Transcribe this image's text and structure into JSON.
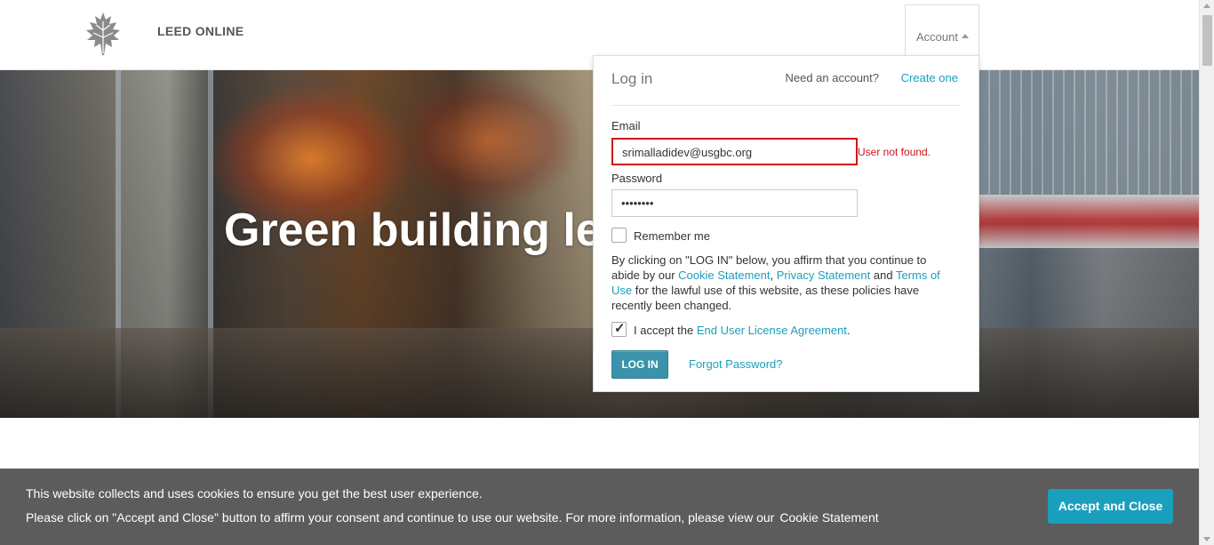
{
  "header": {
    "logo_icon": "usgbc-oak-leaf-logo",
    "brand": "LEED ONLINE",
    "account_label": "Account"
  },
  "hero": {
    "title": "Green building le"
  },
  "login": {
    "title": "Log in",
    "need_account": "Need an account?",
    "create_link": "Create one",
    "email_label": "Email",
    "email_value": "srimalladidev@usgbc.org",
    "email_error": "User not found.",
    "password_label": "Password",
    "password_value": "••••••••",
    "remember_label": "Remember me",
    "remember_checked": false,
    "terms_text_1": "By clicking on \"LOG IN\" below, you affirm that you continue to abide by our ",
    "cookie_link": "Cookie Statement",
    "comma": ", ",
    "privacy_link": "Privacy Statement",
    "and": " and ",
    "terms_link": "Terms of Use",
    "terms_text_2": " for the lawful use of this website, as these policies have recently been changed.",
    "accept_prefix": "I accept the ",
    "eula_link": "End User License Agreement",
    "accept_suffix": ".",
    "accept_checked": true,
    "login_button": "LOG IN",
    "forgot_link": "Forgot Password?"
  },
  "cookie_bar": {
    "line1": "This website collects and uses cookies to ensure you get the best user experience.",
    "line2": "Please click on \"Accept and Close\" button to affirm your consent and continue to use our website. For more information, please view our",
    "cookie_link": "Cookie Statement",
    "accept_button": "Accept and Close"
  },
  "colors": {
    "accent": "#1a9fbd",
    "error": "#d0121b",
    "login_button": "#3a93ab",
    "cookie_bg": "#5c5c5c"
  }
}
